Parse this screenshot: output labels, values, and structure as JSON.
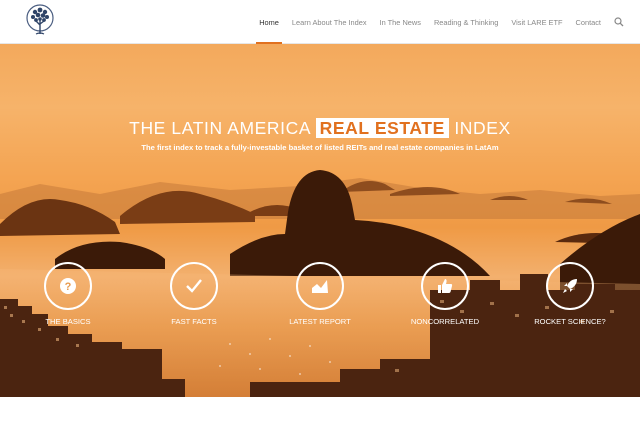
{
  "nav": {
    "items": [
      {
        "label": "Home",
        "active": true
      },
      {
        "label": "Learn About The Index",
        "active": false
      },
      {
        "label": "In The News",
        "active": false
      },
      {
        "label": "Reading & Thinking",
        "active": false
      },
      {
        "label": "Visit LARE ETF",
        "active": false
      },
      {
        "label": "Contact",
        "active": false
      }
    ],
    "search_icon": "magnifier-icon"
  },
  "hero": {
    "title_before": "THE LATIN AMERICA ",
    "title_highlight": "REAL ESTATE",
    "title_after": " INDEX",
    "subtitle": "The first index to track a fully-investable basket of listed REITs and real estate companies in LatAm",
    "features": [
      {
        "label": "THE BASICS",
        "icon": "question-icon"
      },
      {
        "label": "FAST FACTS",
        "icon": "checkmark-icon"
      },
      {
        "label": "LATEST REPORT",
        "icon": "area-chart-icon"
      },
      {
        "label": "NONCORRELATED",
        "icon": "thumbs-up-icon"
      },
      {
        "label": "ROCKET SCIENCE?",
        "icon": "rocket-icon"
      }
    ]
  },
  "colors": {
    "accent": "#e1711f",
    "hero_orange": "#f4a452"
  }
}
